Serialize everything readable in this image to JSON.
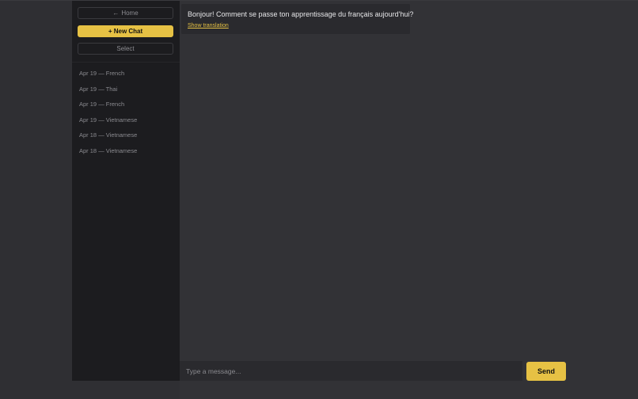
{
  "sidebar": {
    "home_label": "Home",
    "home_icon": "←",
    "new_chat_label": "+ New Chat",
    "select_label": "Select",
    "history": [
      {
        "date": "Apr 19",
        "language": "French"
      },
      {
        "date": "Apr 19",
        "language": "Thai"
      },
      {
        "date": "Apr 19",
        "language": "French"
      },
      {
        "date": "Apr 19",
        "language": "Vietnamese"
      },
      {
        "date": "Apr 18",
        "language": "Vietnamese"
      },
      {
        "date": "Apr 18",
        "language": "Vietnamese"
      }
    ],
    "history_separator": "—"
  },
  "chat": {
    "messages": [
      {
        "text": "Bonjour! Comment se passe ton apprentissage du français aujourd'hui?",
        "translation_link": "Show translation"
      }
    ]
  },
  "composer": {
    "placeholder": "Type a message...",
    "send_label": "Send"
  },
  "colors": {
    "accent": "#e6c144",
    "background": "#2f2f33",
    "sidebar": "#1c1c1f"
  }
}
